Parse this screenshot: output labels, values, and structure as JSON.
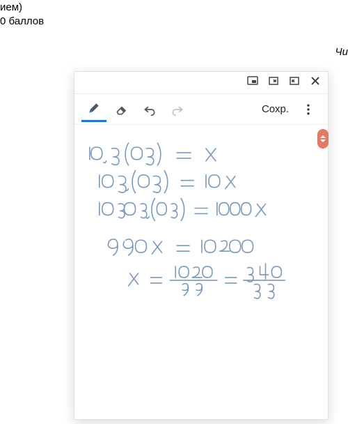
{
  "background": {
    "frag1": "ием)",
    "frag2": "0 баллов",
    "frag3": "Чи"
  },
  "toolbar": {
    "save_label": "Сохр."
  },
  "handwriting": {
    "line1": "10,3(03) = x",
    "line2": "103,(03) = 10x",
    "line3": "10303,(03) = 1000x",
    "line4": "990x = 10200",
    "line5": "x = 1020/99 = 340/33"
  }
}
